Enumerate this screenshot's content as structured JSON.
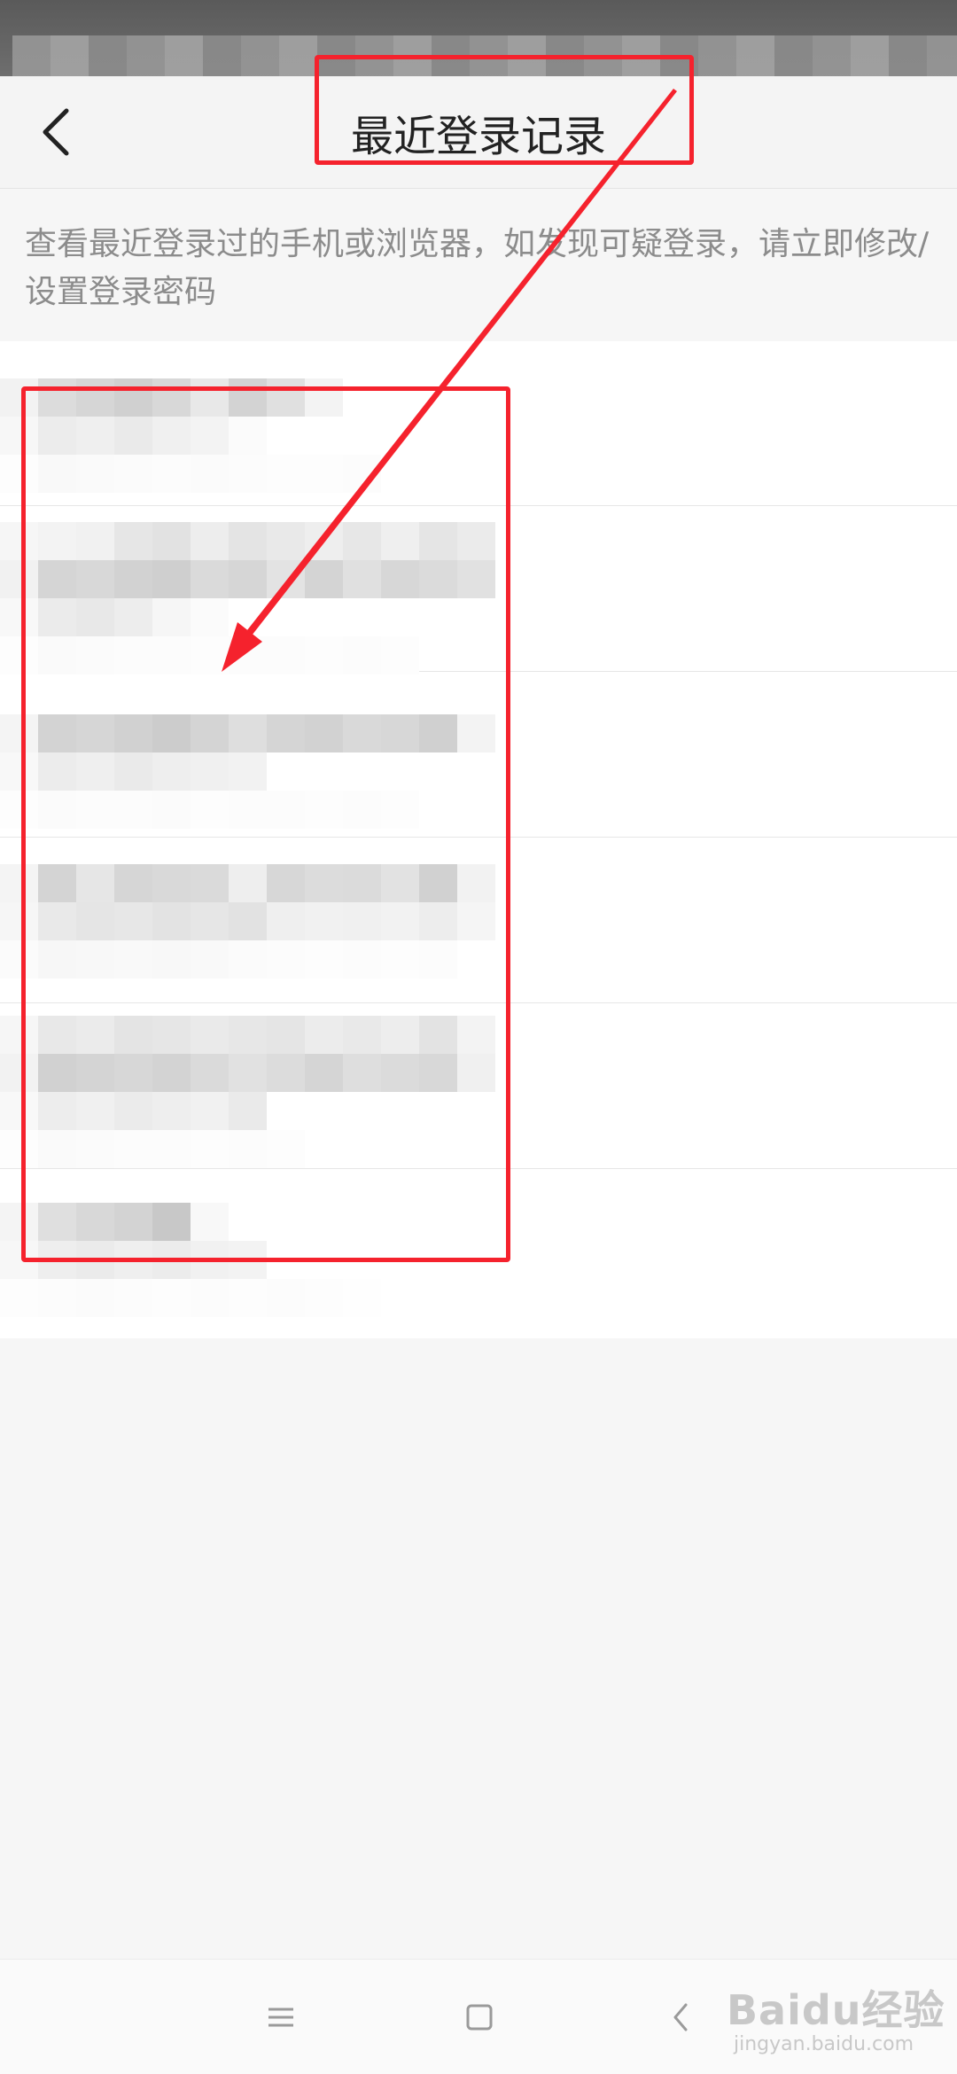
{
  "header": {
    "title": "最近登录记录",
    "back_icon": "chevron-left-icon"
  },
  "notice": {
    "text": "查看最近登录过的手机或浏览器，如发现可疑登录，请立即修改/设置登录密码"
  },
  "login_records_count": 6,
  "nav_bar": {
    "menu_icon": "menu-icon",
    "home_icon": "square-icon",
    "back_icon": "chevron-left-icon"
  },
  "watermark": {
    "text": "Baidu经验",
    "sub": "jingyan.baidu.com"
  },
  "colors": {
    "annotation": "#f5222d",
    "header_bg": "#f4f4f4",
    "page_bg": "#f6f6f6",
    "notice_text": "#8c8c8c",
    "title_text": "#222222"
  }
}
